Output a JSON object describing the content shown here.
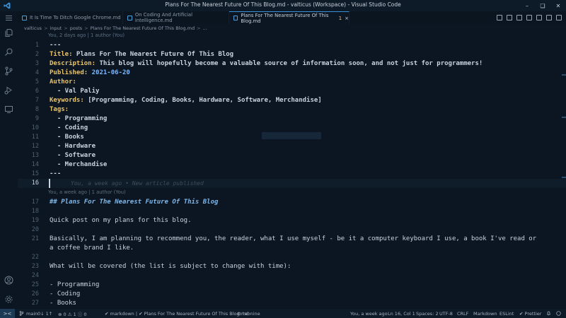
{
  "window": {
    "title": "Plans For The Nearest Future Of This Blog.md - valticus (Workspace) - Visual Studio Code",
    "minimize": "–",
    "maximize": "❏",
    "close": "✕"
  },
  "tabs": [
    {
      "label": "It Is Time To Ditch Google Chrome.md"
    },
    {
      "label": "On Coding And Artificial Intelligence.md"
    },
    {
      "label": "Plans For The Nearest Future Of This Blog.md",
      "modified": "1",
      "close": "×"
    }
  ],
  "breadcrumb": {
    "items": [
      "valticus",
      "input",
      "posts",
      "Plans For The Nearest Future Of This Blog.md",
      "..."
    ],
    "separator": ">"
  },
  "codelens": {
    "top": "You, 2 days ago | 1 author (You)",
    "mid": "You, a week ago | 1 author (You)"
  },
  "editor": {
    "blame_line16": "You, a week ago • New article published",
    "lines": [
      {
        "n": "1",
        "text": "---"
      },
      {
        "n": "2",
        "key": "Title:",
        "val": " Plans For The Nearest Future Of This Blog"
      },
      {
        "n": "3",
        "key": "Description:",
        "val": " This blog will hopefully become a valuable source of information soon, and not just for programmers!"
      },
      {
        "n": "4",
        "key": "Published:",
        "num": " 2021-06-20"
      },
      {
        "n": "5",
        "key": "Author:"
      },
      {
        "n": "6",
        "text": "  - Val Paliy"
      },
      {
        "n": "7",
        "key": "Keywords:",
        "val": " [Programming, Coding, Books, Hardware, Software, Merchandise]"
      },
      {
        "n": "8",
        "key": "Tags:"
      },
      {
        "n": "9",
        "text": "  - Programming"
      },
      {
        "n": "10",
        "text": "  - Coding"
      },
      {
        "n": "11",
        "text": "  - Books"
      },
      {
        "n": "12",
        "text": "  - Hardware"
      },
      {
        "n": "13",
        "text": "  - Software"
      },
      {
        "n": "14",
        "text": "  - Merchandise"
      },
      {
        "n": "15",
        "text": "---"
      },
      {
        "n": "16",
        "text": ""
      },
      {
        "n": "17",
        "heading": "## Plans For The Nearest Future Of This Blog"
      },
      {
        "n": "18",
        "text": ""
      },
      {
        "n": "19",
        "text": "Quick post on my plans for this blog."
      },
      {
        "n": "20",
        "text": ""
      },
      {
        "n": "21",
        "text": "Basically, I am planning to recommend you, the reader, what I use myself - be it a computer keyboard I use, a book I've read or"
      },
      {
        "n": "",
        "text": "a coffee brand I like."
      },
      {
        "n": "22",
        "text": ""
      },
      {
        "n": "23",
        "text": "What will be covered (the list is subject to change with time):"
      },
      {
        "n": "24",
        "text": ""
      },
      {
        "n": "25",
        "text": "- Programming"
      },
      {
        "n": "26",
        "text": "- Coding"
      },
      {
        "n": "27",
        "text": "- Books"
      }
    ]
  },
  "status": {
    "remote": "><",
    "branch": "main",
    "sync": "0↓ 1↑",
    "problems": "⊗ 0  ⚠ 1  ⓘ 0",
    "language_check": "✔ markdown | ✔ Plans For The Nearest Future Of This Blog.md",
    "tabnine": "⚙ tabnine",
    "blame": "You, a week ago",
    "position": "Ln 16, Col 1",
    "spaces": "Spaces: 2",
    "encoding": "UTF-8",
    "eol": "CRLF",
    "language": "Markdown",
    "eslint": "ESLint",
    "prettier": "✔ Prettier"
  },
  "colors": {
    "background": "#0b1622",
    "key": "#e8c36a",
    "number": "#79b8ff",
    "heading": "#7fb6e8",
    "accent": "#3a8fd6"
  }
}
